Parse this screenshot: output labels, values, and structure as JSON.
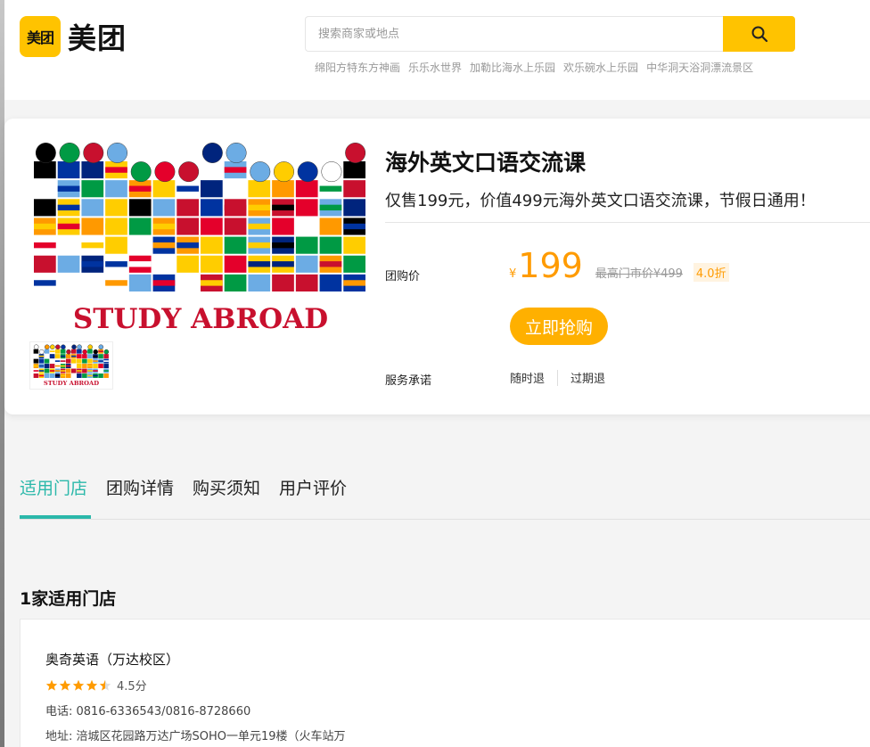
{
  "header": {
    "logo_badge": "美团",
    "logo_text": "美团",
    "search_placeholder": "搜索商家或地点",
    "hot_words": [
      "绵阳方特东方神画",
      "乐乐水世界",
      "加勒比海水上乐园",
      "欢乐碗水上乐园",
      "中华洞天浴洞漂流景区"
    ]
  },
  "deal": {
    "title": "海外英文口语交流课",
    "subtitle": "仅售199元，价值499元海外英文口语交流课，节假日通用！",
    "image_caption": "STUDY ABROAD",
    "price_label": "团购价",
    "currency": "¥",
    "price": "199",
    "original_price": "最高门市价¥499",
    "discount": "4.0折",
    "buy_label": "立即抢购",
    "service_label": "服务承诺",
    "services": [
      "随时退",
      "过期退"
    ]
  },
  "tabs": [
    {
      "label": "适用门店",
      "active": true
    },
    {
      "label": "团购详情",
      "active": false
    },
    {
      "label": "购买须知",
      "active": false
    },
    {
      "label": "用户评价",
      "active": false
    }
  ],
  "stores": {
    "count_label": "1家适用门店",
    "items": [
      {
        "name": "奥奇英语（万达校区）",
        "rating": 4.5,
        "score_label": "4.5分",
        "phone": "电话: 0816-6336543/0816-8728660",
        "address": "地址: 涪城区花园路万达广场SOHO一单元19楼（火车站万"
      }
    ]
  },
  "colors": {
    "brand_yellow": "#ffc300",
    "price_orange": "#ff9b00",
    "tab_teal": "#2bb8aa"
  }
}
